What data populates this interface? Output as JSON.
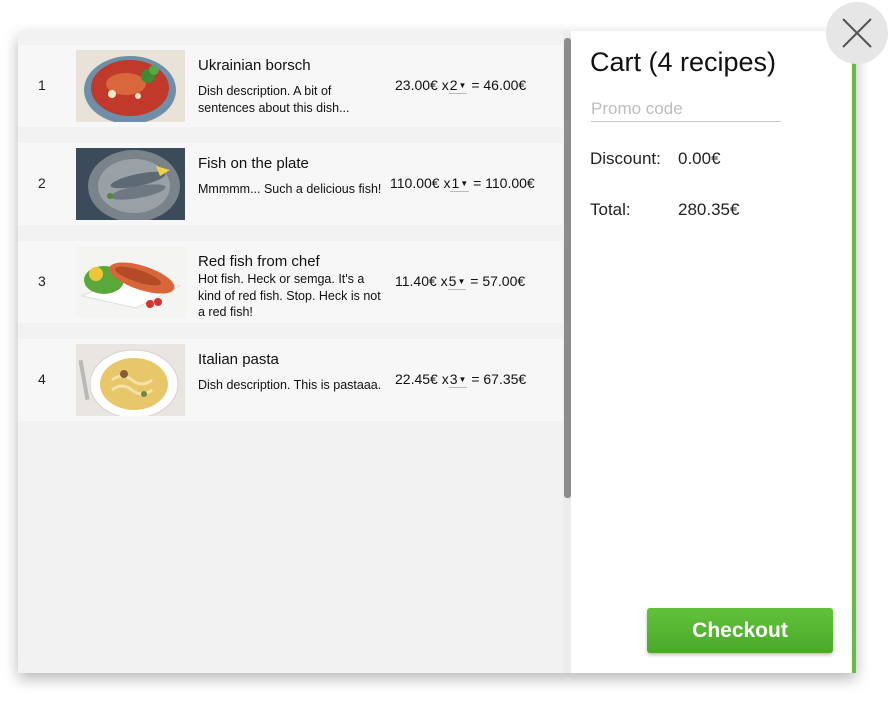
{
  "cart": {
    "title": "Cart (4 recipes)",
    "promo_placeholder": "Promo code",
    "discount_label": "Discount:",
    "discount_value": "0.00€",
    "total_label": "Total:",
    "total_value": "280.35€",
    "checkout_label": "Checkout"
  },
  "items": [
    {
      "num": "1",
      "title": "Ukrainian borsch",
      "desc": "Dish description. A bit of sentences about this dish...",
      "price": "23.00€ x",
      "qty": "2",
      "sum": "= 46.00€"
    },
    {
      "num": "2",
      "title": "Fish on the plate",
      "desc": "Mmmmm... Such a delicious fish!",
      "price": "110.00€ x",
      "qty": "1",
      "sum": "= 110.00€"
    },
    {
      "num": "3",
      "title": "Red fish from chef",
      "desc": "Hot fish. Heck or semga. It's a kind of red fish. Stop. Heck is not a red fish!",
      "price": "11.40€ x",
      "qty": "5",
      "sum": "= 57.00€"
    },
    {
      "num": "4",
      "title": "Italian pasta",
      "desc": "Dish description. This is pastaaa.",
      "price": "22.45€ x",
      "qty": "3",
      "sum": "= 67.35€"
    }
  ],
  "icons": {
    "close": "close-icon",
    "dropdown": "dropdown-arrow-icon"
  },
  "colors": {
    "accent": "#5cb833",
    "panel": "#f2f2f2"
  }
}
